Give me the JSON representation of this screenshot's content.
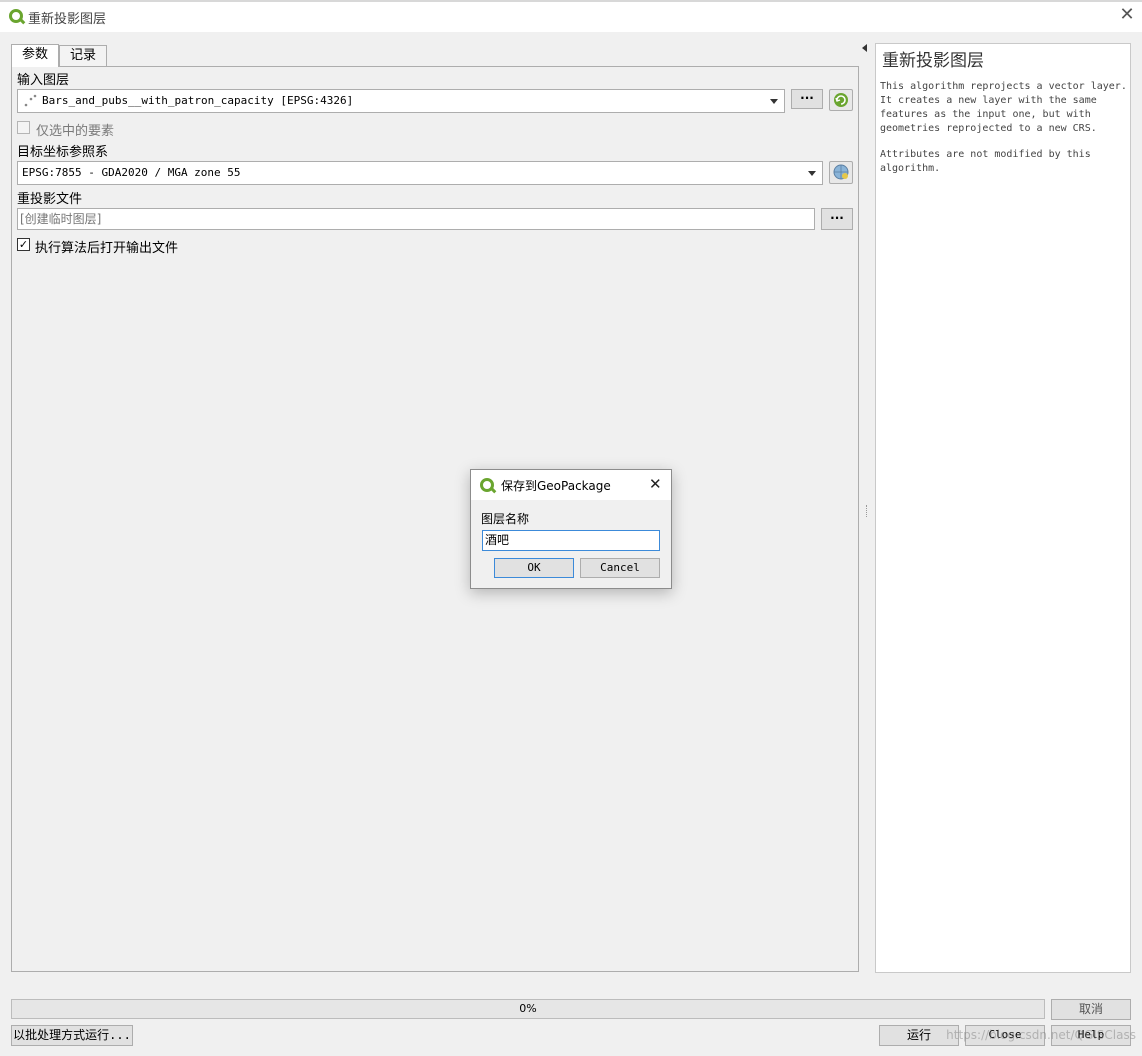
{
  "window": {
    "title": "重新投影图层",
    "close_glyph": "✕"
  },
  "tabs": [
    {
      "label": "参数"
    },
    {
      "label": "记录"
    }
  ],
  "params": {
    "input_layer": {
      "label": "输入图层",
      "value": "Bars_and_pubs__with_patron_capacity [EPSG:4326]",
      "ellipsis": "···"
    },
    "selected_only": {
      "label": "仅选中的要素",
      "checked": false
    },
    "target_crs": {
      "label": "目标坐标参照系",
      "value": "EPSG:7855 - GDA2020 / MGA zone 55"
    },
    "output": {
      "label": "重投影文件",
      "placeholder": "[创建临时图层]",
      "ellipsis": "···"
    },
    "open_output": {
      "label": "执行算法后打开输出文件",
      "checked": true,
      "check_glyph": "✓"
    }
  },
  "help": {
    "title": "重新投影图层",
    "paragraphs": [
      "This algorithm reprojects a vector layer. It creates a new layer with the same features as the input one, but with geometries reprojected to a new CRS.",
      "Attributes are not modified by this algorithm."
    ]
  },
  "progress": {
    "text": "0%",
    "value": 0
  },
  "buttons": {
    "cancel": "取消",
    "batch": "以批处理方式运行...",
    "run": "运行",
    "close": "Close",
    "help": "Help"
  },
  "watermark": "https://blog.csdn.net/QGISClass",
  "dialog": {
    "title": "保存到GeoPackage",
    "close_glyph": "✕",
    "field_label": "图层名称",
    "field_value": "酒吧",
    "ok": "OK",
    "cancel": "Cancel"
  },
  "colors": {
    "qgis_green": "#6aa52f",
    "focus_blue": "#3c8ad9"
  }
}
